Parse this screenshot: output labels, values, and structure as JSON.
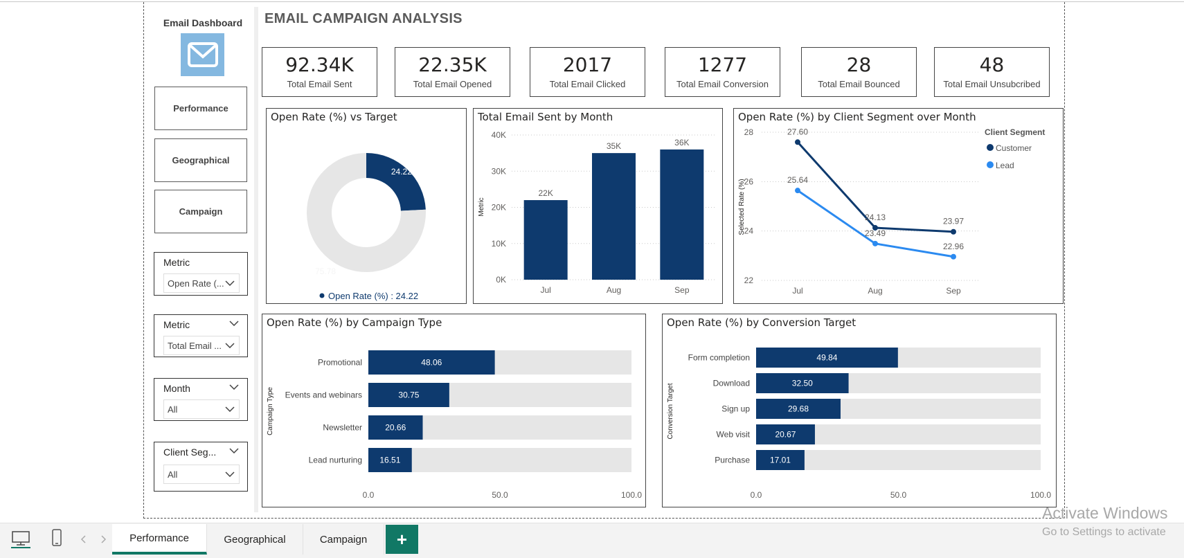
{
  "sidebar": {
    "title": "Email Dashboard",
    "nav": [
      "Performance",
      "Geographical",
      "Campaign"
    ],
    "slicers": [
      {
        "label": "Metric",
        "value": "Open Rate (...",
        "has_header_chevron": false
      },
      {
        "label": "Metric",
        "value": "Total Email ...",
        "has_header_chevron": true
      },
      {
        "label": "Month",
        "value": "All",
        "has_header_chevron": true
      },
      {
        "label": "Client Seg...",
        "value": "All",
        "has_header_chevron": true
      }
    ]
  },
  "header": {
    "title": "EMAIL CAMPAIGN ANALYSIS"
  },
  "kpis": [
    {
      "value": "92.34K",
      "label": "Total Email Sent"
    },
    {
      "value": "22.35K",
      "label": "Total Email Opened"
    },
    {
      "value": "2017",
      "label": "Total Email Clicked"
    },
    {
      "value": "1277",
      "label": "Total Email Conversion"
    },
    {
      "value": "28",
      "label": "Total Email Bounced"
    },
    {
      "value": "48",
      "label": "Total Email Unsubcribed"
    }
  ],
  "colors": {
    "navy": "#0e3a6e",
    "blue": "#2b8af0",
    "grey": "#e6e6e6",
    "teal": "#117865"
  },
  "donut": {
    "title": "Open Rate (%) vs Target",
    "value_label": "24.22",
    "remainder_label": "75.78",
    "legend": "Open Rate (%) : 24.22"
  },
  "chart_data": [
    {
      "type": "pie",
      "title": "Open Rate (%) vs Target",
      "categories": [
        "Open Rate (%)",
        "Remaining"
      ],
      "values": [
        24.22,
        75.78
      ]
    },
    {
      "type": "bar",
      "title": "Total Email Sent by Month",
      "categories": [
        "Jul",
        "Aug",
        "Sep"
      ],
      "values": [
        22000,
        35000,
        36000
      ],
      "data_labels": [
        "22K",
        "35K",
        "36K"
      ],
      "ylabel": "Metric",
      "yticks": [
        "0K",
        "10K",
        "20K",
        "30K",
        "40K"
      ],
      "ylim": [
        0,
        40000
      ]
    },
    {
      "type": "line",
      "title": "Open Rate (%) by Client Segment over Month",
      "categories": [
        "Jul",
        "Aug",
        "Sep"
      ],
      "ylabel": "Selected Rate (%)",
      "yticks": [
        "22",
        "24",
        "26",
        "28"
      ],
      "ylim": [
        22,
        28
      ],
      "legend_title": "Client Segment",
      "series": [
        {
          "name": "Customer",
          "values": [
            27.6,
            24.13,
            23.97
          ],
          "labels": [
            "27.60",
            "24.13",
            "23.97"
          ]
        },
        {
          "name": "Lead",
          "values": [
            25.64,
            23.49,
            22.96
          ],
          "labels": [
            "25.64",
            "23.49",
            "22.96"
          ]
        }
      ]
    },
    {
      "type": "bar",
      "orientation": "horizontal",
      "title": "Open Rate (%) by Campaign Type",
      "ylabel": "Campaign Type",
      "categories": [
        "Promotional",
        "Events and webinars",
        "Newsletter",
        "Lead nurturing"
      ],
      "values": [
        48.06,
        30.75,
        20.66,
        16.51
      ],
      "labels": [
        "48.06",
        "30.75",
        "20.66",
        "16.51"
      ],
      "xticks": [
        "0.0",
        "50.0",
        "100.0"
      ],
      "xlim": [
        0,
        100
      ]
    },
    {
      "type": "bar",
      "orientation": "horizontal",
      "title": "Open Rate (%) by Conversion Target",
      "ylabel": "Conversion Target",
      "categories": [
        "Form completion",
        "Download",
        "Sign up",
        "Web visit",
        "Purchase"
      ],
      "values": [
        49.84,
        32.5,
        29.68,
        20.67,
        17.01
      ],
      "labels": [
        "49.84",
        "32.50",
        "29.68",
        "20.67",
        "17.01"
      ],
      "xticks": [
        "0.0",
        "50.0",
        "100.0"
      ],
      "xlim": [
        0,
        100
      ]
    }
  ],
  "tabs": [
    "Performance",
    "Geographical",
    "Campaign"
  ],
  "add_tab": "+",
  "watermark": {
    "line1": "Activate Windows",
    "line2": "Go to Settings to activate"
  }
}
